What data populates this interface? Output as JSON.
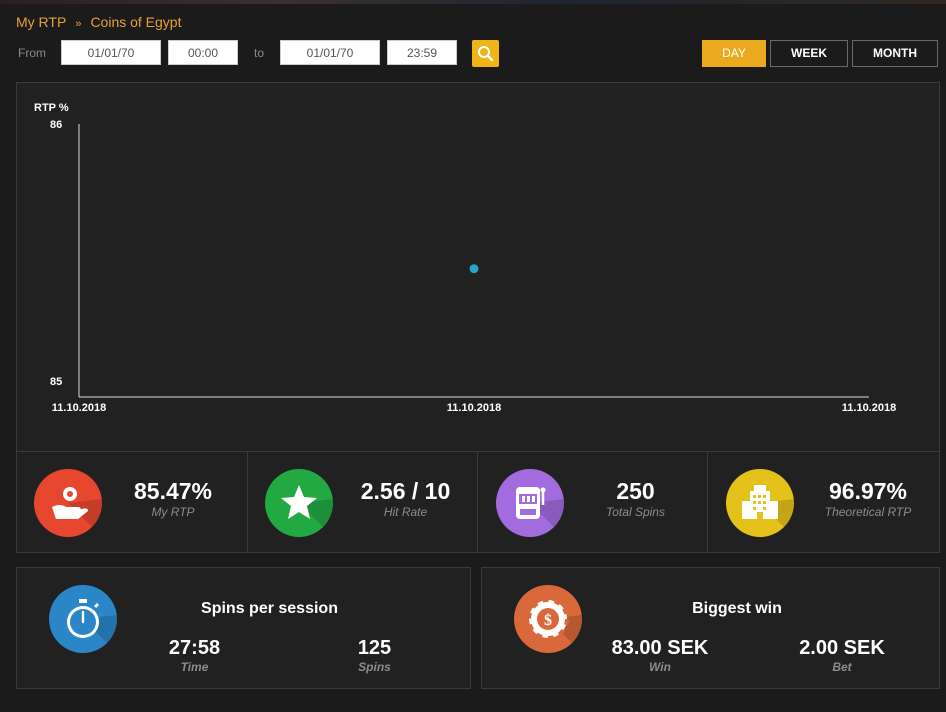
{
  "breadcrumb": {
    "parent": "My RTP",
    "separator": "»",
    "current": "Coins of Egypt"
  },
  "filters": {
    "from_label": "From",
    "from_date": "01/01/70",
    "from_time": "00:00",
    "to_label": "to",
    "to_date": "01/01/70",
    "to_time": "23:59",
    "search_icon": "search-icon"
  },
  "range_tabs": [
    {
      "label": "DAY",
      "active": true
    },
    {
      "label": "WEEK",
      "active": false
    },
    {
      "label": "MONTH",
      "active": false
    }
  ],
  "chart_data": {
    "type": "scatter",
    "ylabel": "RTP %",
    "ylim": [
      85,
      86
    ],
    "y_ticks": [
      "86",
      "85"
    ],
    "x_ticks": [
      "11.10.2018",
      "11.10.2018",
      "11.10.2018"
    ],
    "points": [
      {
        "x": "11.10.2018",
        "y": 85.47
      }
    ],
    "point_color": "#29a3c9",
    "grid": false
  },
  "stats": [
    {
      "value": "85.47%",
      "label": "My RTP",
      "icon": "hand-coin-icon",
      "color": "#e8472f"
    },
    {
      "value": "2.56 / 10",
      "label": "Hit Rate",
      "icon": "star-icon",
      "color": "#23a942"
    },
    {
      "value": "250",
      "label": "Total Spins",
      "icon": "slot-machine-icon",
      "color": "#a36cde"
    },
    {
      "value": "96.97%",
      "label": "Theoretical RTP",
      "icon": "casino-building-icon",
      "color": "#e5c21a"
    }
  ],
  "session": {
    "title": "Spins per session",
    "time_value": "27:58",
    "time_label": "Time",
    "spins_value": "125",
    "spins_label": "Spins",
    "icon": "stopwatch-icon",
    "color": "#2b86c8"
  },
  "biggest_win": {
    "title": "Biggest win",
    "win_value": "83.00 SEK",
    "win_label": "Win",
    "bet_value": "2.00 SEK",
    "bet_label": "Bet",
    "icon": "casino-chip-icon",
    "color": "#d9683a"
  }
}
